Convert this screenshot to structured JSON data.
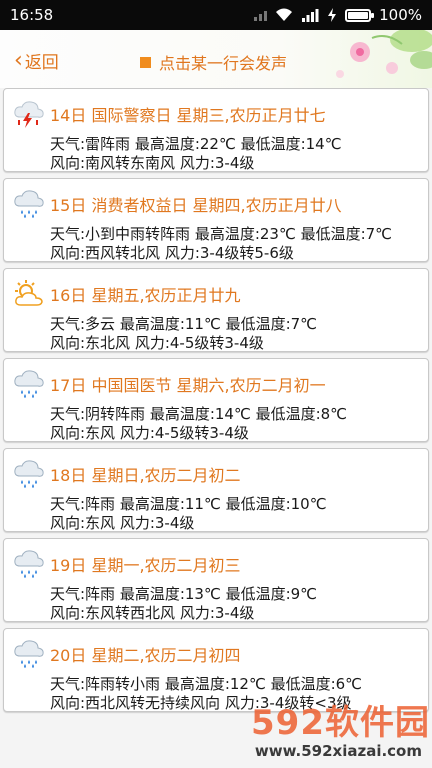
{
  "status_bar": {
    "time": "16:58",
    "battery": "100%"
  },
  "header": {
    "back_label": "返回",
    "hint": "点击某一行会发声"
  },
  "days": [
    {
      "icon": "thunderstorm-icon",
      "title": "14日 国际警察日 星期三,农历正月廿七",
      "line1": "天气:雷阵雨  最高温度:22℃ 最低温度:14℃",
      "line2": "风向:南风转东南风  风力:3-4级"
    },
    {
      "icon": "rain-cloud-icon",
      "title": "15日 消费者权益日 星期四,农历正月廿八",
      "line1": "天气:小到中雨转阵雨  最高温度:23℃ 最低温度:7℃",
      "line2": "风向:西风转北风  风力:3-4级转5-6级"
    },
    {
      "icon": "partly-cloudy-icon",
      "title": "16日  星期五,农历正月廿九",
      "line1": "天气:多云  最高温度:11℃ 最低温度:7℃",
      "line2": "风向:东北风  风力:4-5级转3-4级"
    },
    {
      "icon": "rain-cloud-icon",
      "title": "17日 中国国医节 星期六,农历二月初一",
      "line1": "天气:阴转阵雨  最高温度:14℃ 最低温度:8℃",
      "line2": "风向:东风  风力:4-5级转3-4级"
    },
    {
      "icon": "rain-cloud-icon",
      "title": "18日  星期日,农历二月初二",
      "line1": "天气:阵雨  最高温度:11℃ 最低温度:10℃",
      "line2": "风向:东风  风力:3-4级"
    },
    {
      "icon": "rain-cloud-icon",
      "title": "19日  星期一,农历二月初三",
      "line1": "天气:阵雨  最高温度:13℃ 最低温度:9℃",
      "line2": "风向:东风转西北风  风力:3-4级"
    },
    {
      "icon": "rain-cloud-icon",
      "title": "20日  星期二,农历二月初四",
      "line1": "天气:阵雨转小雨  最高温度:12℃ 最低温度:6℃",
      "line2": "风向:西北风转无持续风向  风力:3-4级转<3级"
    }
  ],
  "watermark": {
    "brand": "592软件园",
    "url": "www.592xiazai.com"
  },
  "colors": {
    "accent": "#e07820",
    "statusbar": "#0a0a0a"
  }
}
